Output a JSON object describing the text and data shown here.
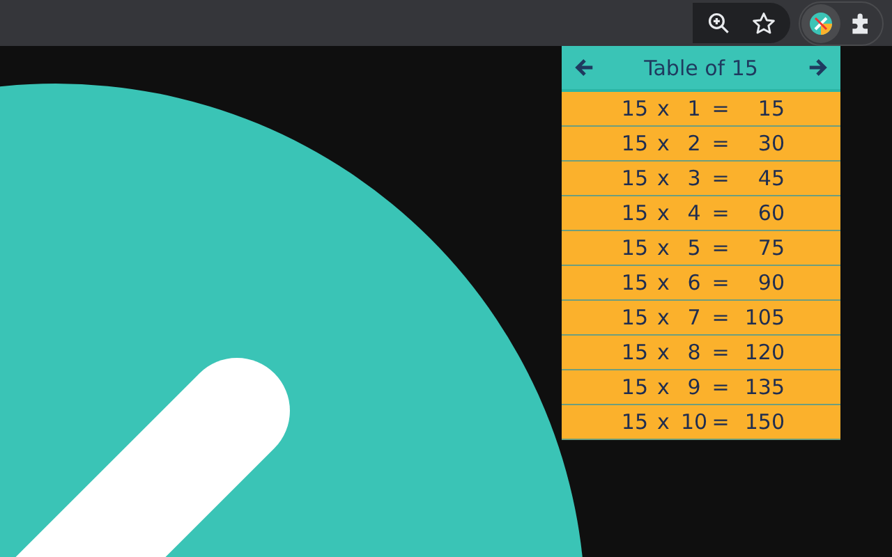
{
  "popup": {
    "title": "Table of 15",
    "rows": [
      {
        "multiplicand": "15",
        "sign": "x",
        "multiplier": "1",
        "equals": "=",
        "product": "15"
      },
      {
        "multiplicand": "15",
        "sign": "x",
        "multiplier": "2",
        "equals": "=",
        "product": "30"
      },
      {
        "multiplicand": "15",
        "sign": "x",
        "multiplier": "3",
        "equals": "=",
        "product": "45"
      },
      {
        "multiplicand": "15",
        "sign": "x",
        "multiplier": "4",
        "equals": "=",
        "product": "60"
      },
      {
        "multiplicand": "15",
        "sign": "x",
        "multiplier": "5",
        "equals": "=",
        "product": "75"
      },
      {
        "multiplicand": "15",
        "sign": "x",
        "multiplier": "6",
        "equals": "=",
        "product": "90"
      },
      {
        "multiplicand": "15",
        "sign": "x",
        "multiplier": "7",
        "equals": "=",
        "product": "105"
      },
      {
        "multiplicand": "15",
        "sign": "x",
        "multiplier": "8",
        "equals": "=",
        "product": "120"
      },
      {
        "multiplicand": "15",
        "sign": "x",
        "multiplier": "9",
        "equals": "=",
        "product": "135"
      },
      {
        "multiplicand": "15",
        "sign": "x",
        "multiplier": "10",
        "equals": "=",
        "product": "150"
      }
    ]
  }
}
